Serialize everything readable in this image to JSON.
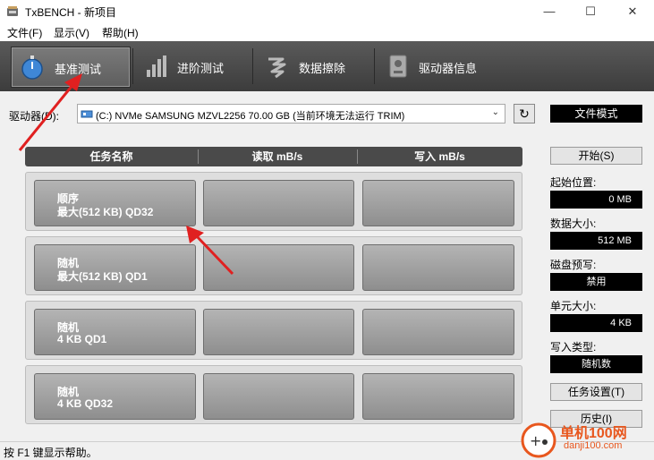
{
  "window": {
    "title": "TxBENCH - 新项目",
    "minimize": "—",
    "maximize": "☐",
    "close": "✕"
  },
  "menu": {
    "file": "文件(F)",
    "view": "显示(V)",
    "help": "帮助(H)"
  },
  "toolbar": {
    "tabs": [
      {
        "label": "基准测试",
        "icon": "stopwatch-icon",
        "active": true
      },
      {
        "label": "进阶测试",
        "icon": "bar-chart-icon",
        "active": false
      },
      {
        "label": "数据擦除",
        "icon": "erase-icon",
        "active": false
      },
      {
        "label": "驱动器信息",
        "icon": "drive-info-icon",
        "active": false
      }
    ]
  },
  "drive": {
    "label": "驱动器(D):",
    "selected": "(C:) NVMe SAMSUNG MZVL2256  70.00 GB (当前环境无法运行 TRIM)",
    "mode": "文件模式"
  },
  "table": {
    "headers": [
      "任务名称",
      "读取 mB/s",
      "写入 mB/s"
    ],
    "rows": [
      {
        "line1": "顺序",
        "line2": "最大(512 KB) QD32",
        "read": "",
        "write": ""
      },
      {
        "line1": "随机",
        "line2": "最大(512 KB) QD1",
        "read": "",
        "write": ""
      },
      {
        "line1": "随机",
        "line2": "4 KB QD1",
        "read": "",
        "write": ""
      },
      {
        "line1": "随机",
        "line2": "4 KB QD32",
        "read": "",
        "write": ""
      }
    ]
  },
  "side": {
    "start": "开始(S)",
    "start_pos_label": "起始位置:",
    "start_pos_value": "0 MB",
    "data_size_label": "数据大小:",
    "data_size_value": "512 MB",
    "precondition_label": "磁盘预写:",
    "precondition_value": "禁用",
    "unit_size_label": "单元大小:",
    "unit_size_value": "4 KB",
    "write_type_label": "写入类型:",
    "write_type_value": "随机数",
    "task_settings": "任务设置(T)",
    "history": "历史(I)"
  },
  "status": {
    "text": "按 F1 键显示帮助。"
  },
  "watermark": {
    "line1": "单机100网",
    "line2": "danji100.com"
  },
  "colors": {
    "toolbar_bg": "#4a4a4a",
    "tile": "#a0a0a0",
    "annotation_arrow": "#e02020",
    "watermark": "#e8571e"
  }
}
